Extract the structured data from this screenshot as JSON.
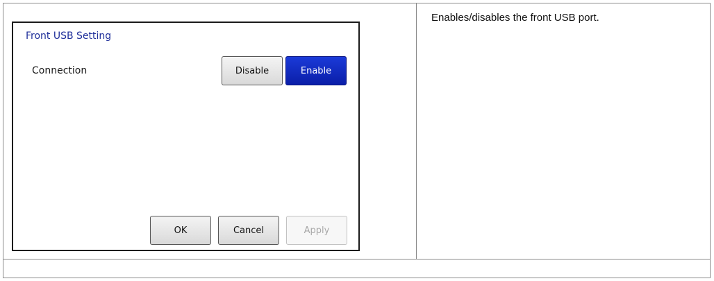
{
  "description": "Enables/disables the front USB port.",
  "dialog": {
    "title": "Front USB Setting",
    "connection_label": "Connection",
    "toggle": {
      "disable_label": "Disable",
      "enable_label": "Enable",
      "selected": "Enable"
    },
    "footer": {
      "ok_label": "OK",
      "cancel_label": "Cancel",
      "apply_label": "Apply"
    }
  },
  "colors": {
    "selected_button": "#0a1ea8",
    "title_text": "#1f2f9a"
  }
}
